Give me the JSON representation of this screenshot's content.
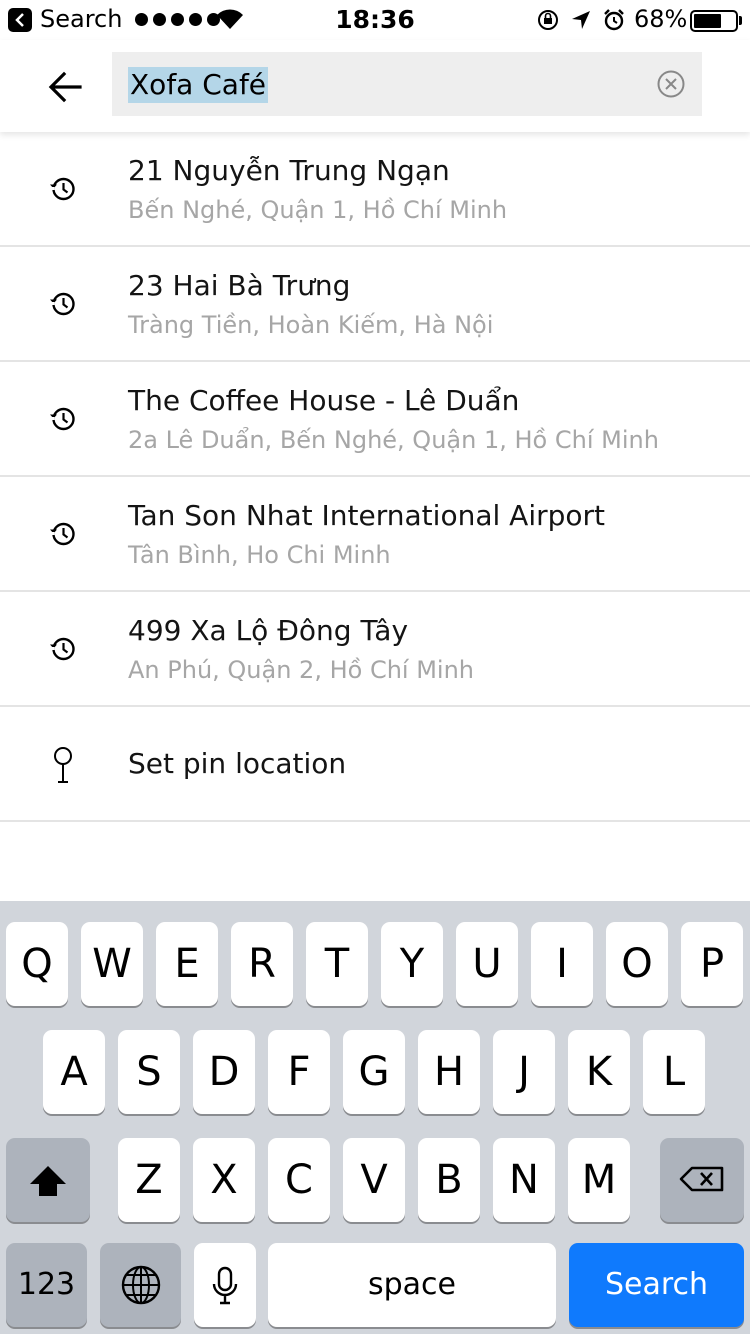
{
  "status_bar": {
    "back_label": "Search",
    "time": "18:36",
    "battery_text": "68%",
    "battery_level": 0.68,
    "icons": [
      "cellular-dots-icon",
      "wifi-icon",
      "orientation-lock-icon",
      "location-arrow-icon",
      "alarm-icon",
      "battery-icon"
    ]
  },
  "header": {
    "back_icon": "back-arrow-icon",
    "search_value": "Xofa Café",
    "clear_icon": "clear-circle-icon"
  },
  "results": [
    {
      "title": "21 Nguyễn Trung Ngạn",
      "subtitle": "Bến Nghé, Quận 1, Hồ Chí Minh",
      "icon": "history-clock-icon"
    },
    {
      "title": "23 Hai Bà Trưng",
      "subtitle": "Tràng Tiền, Hoàn Kiếm, Hà Nội",
      "icon": "history-clock-icon"
    },
    {
      "title": "The Coffee House - Lê Duẩn",
      "subtitle": "2a Lê Duẩn, Bến Nghé, Quận 1, Hồ Chí Minh",
      "icon": "history-clock-icon"
    },
    {
      "title": "Tan Son Nhat International Airport",
      "subtitle": "Tân Bình, Ho Chi Minh",
      "icon": "history-clock-icon"
    },
    {
      "title": "499 Xa Lộ Đông Tây",
      "subtitle": "An Phú, Quận 2, Hồ Chí Minh",
      "icon": "history-clock-icon"
    }
  ],
  "pin_item": {
    "label": "Set pin location",
    "icon": "map-pin-icon"
  },
  "keyboard": {
    "row1": [
      "Q",
      "W",
      "E",
      "R",
      "T",
      "Y",
      "U",
      "I",
      "O",
      "P"
    ],
    "row2": [
      "A",
      "S",
      "D",
      "F",
      "G",
      "H",
      "J",
      "K",
      "L"
    ],
    "row3": [
      "Z",
      "X",
      "C",
      "V",
      "B",
      "N",
      "M"
    ],
    "numbers_label": "123",
    "space_label": "space",
    "search_label": "Search",
    "shift_icon": "shift-arrow-icon",
    "delete_icon": "backspace-icon",
    "globe_icon": "globe-icon",
    "mic_icon": "microphone-icon",
    "colors": {
      "search_key": "#0f7afd",
      "background": "#d1d5db",
      "func_key": "#adb3bc"
    }
  }
}
